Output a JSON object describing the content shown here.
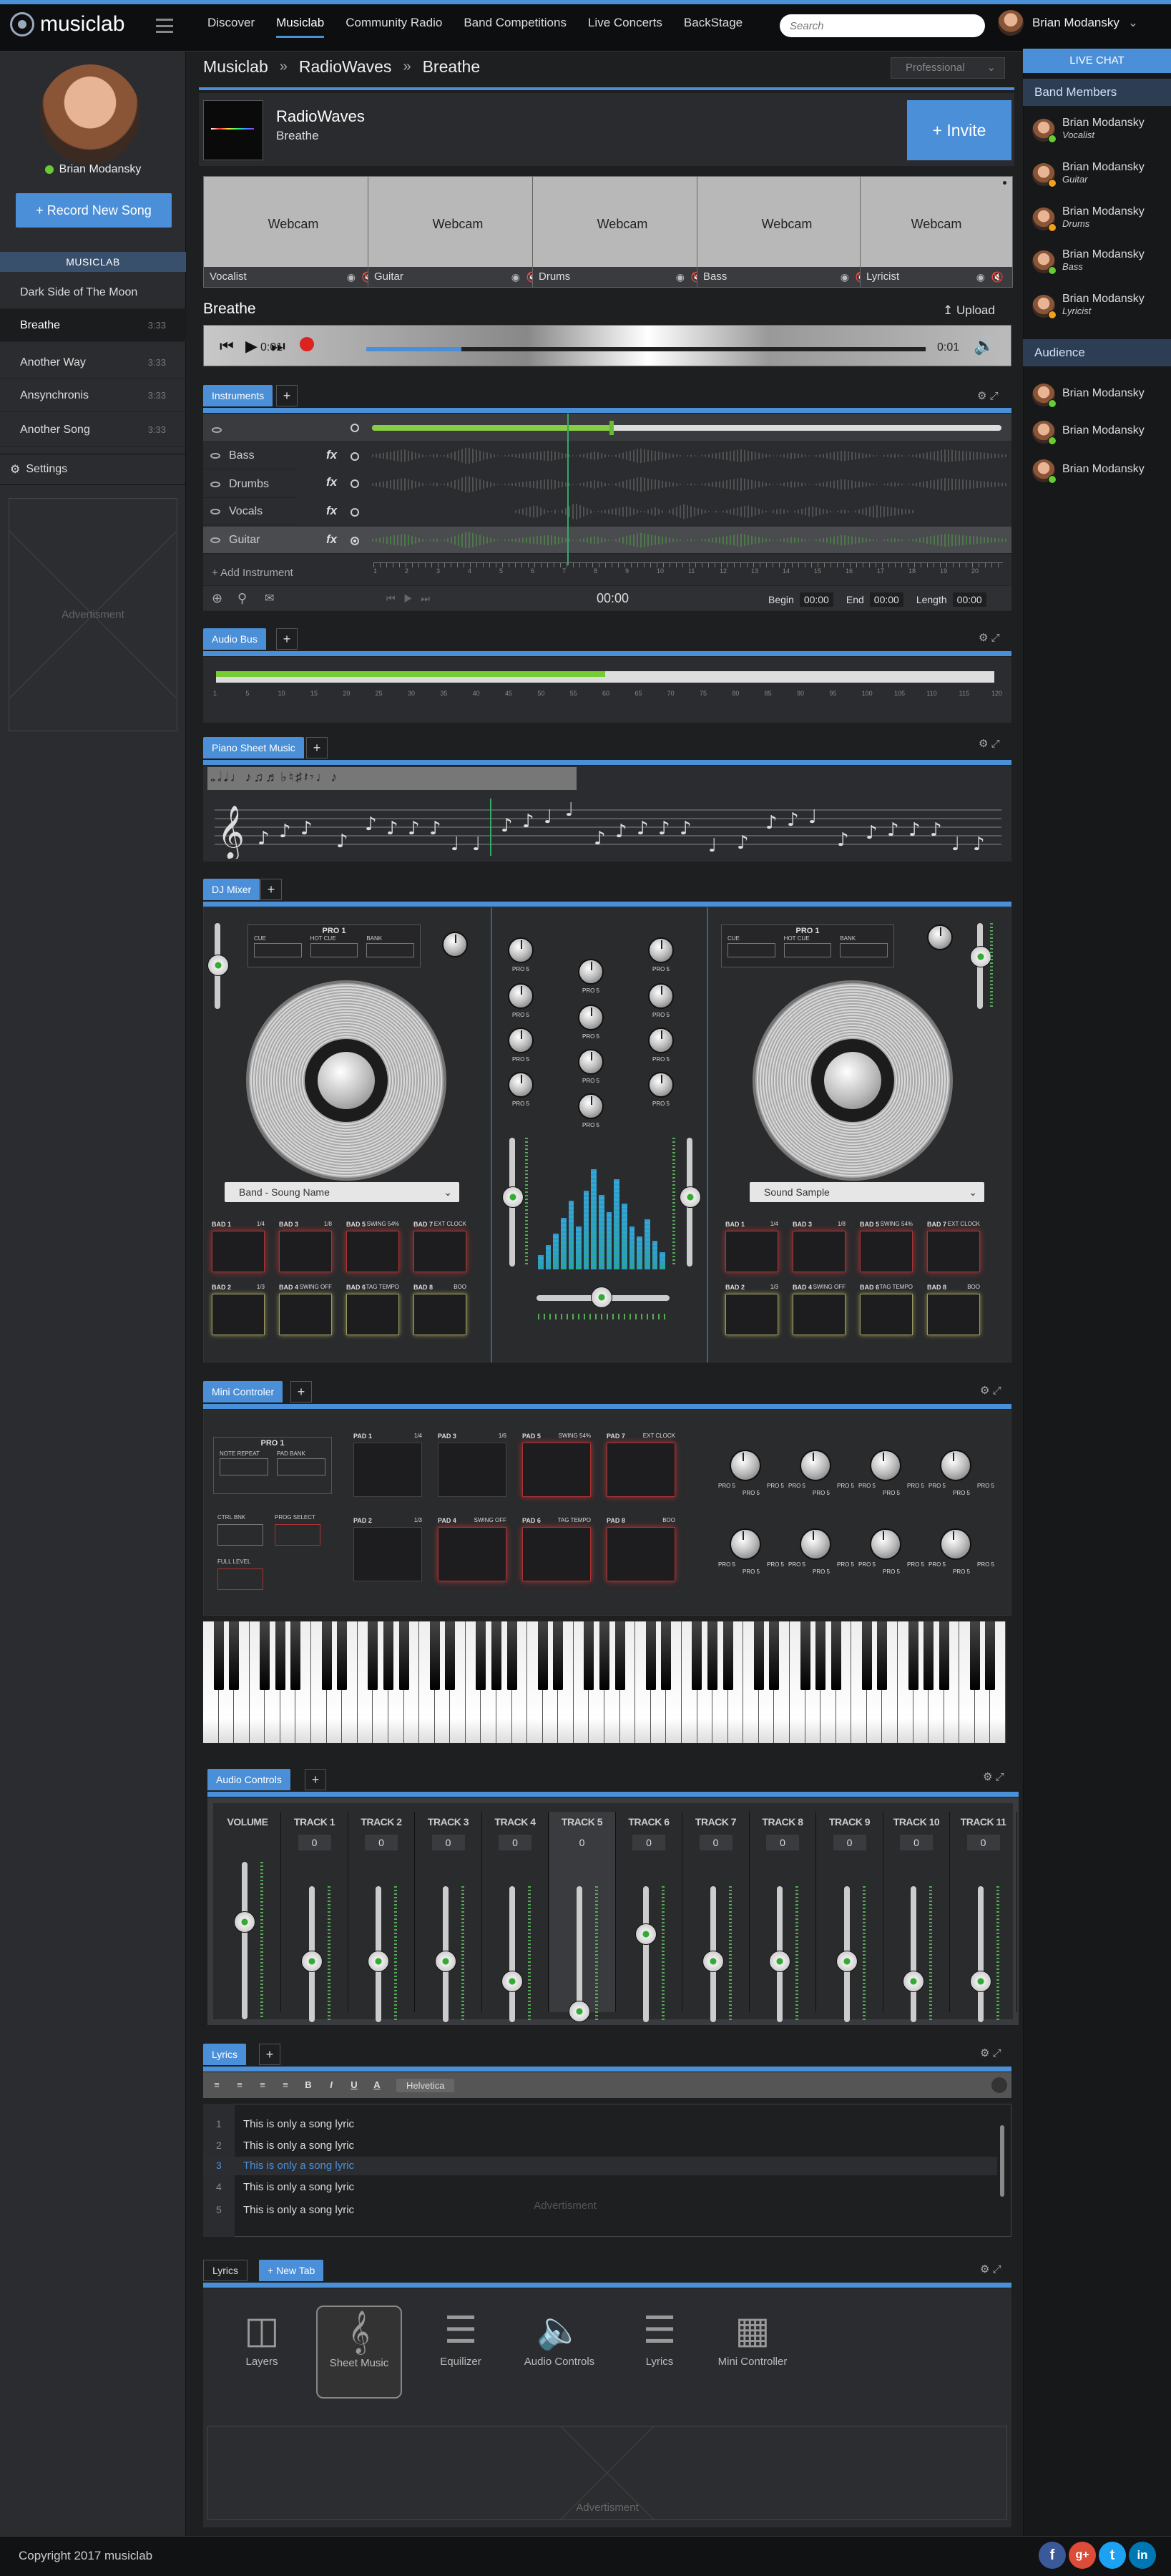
{
  "app": {
    "name": "musiclab"
  },
  "nav": {
    "items": [
      "Discover",
      "Musiclab",
      "Community Radio",
      "Band Competitions",
      "Live Concerts",
      "BackStage"
    ],
    "active": "Musiclab"
  },
  "search": {
    "placeholder": "Search"
  },
  "user": {
    "name": "Brian Modansky"
  },
  "sidebar": {
    "record_label": "Record New Song",
    "section_title": "MUSICLAB",
    "songs": [
      {
        "title": "Dark Side of The Moon",
        "duration": ""
      },
      {
        "title": "Breathe",
        "duration": "3:33"
      },
      {
        "title": "Another Way",
        "duration": "3:33"
      },
      {
        "title": "Ansynchronis",
        "duration": "3:33"
      },
      {
        "title": "Another Song",
        "duration": "3:33"
      }
    ],
    "settings_label": "Settings",
    "ad_label": "Advertisment"
  },
  "breadcrumb": {
    "items": [
      "Musiclab",
      "RadioWaves",
      "Breathe"
    ],
    "separator": "»"
  },
  "tier_select": {
    "value": "Professional"
  },
  "project": {
    "band": "RadioWaves",
    "song": "Breathe",
    "invite_label": "Invite"
  },
  "webcams": [
    {
      "label": "Webcam",
      "role": "Vocalist"
    },
    {
      "label": "Webcam",
      "role": "Guitar"
    },
    {
      "label": "Webcam",
      "role": "Drums"
    },
    {
      "label": "Webcam",
      "role": "Bass"
    },
    {
      "label": "Webcam",
      "role": "Lyricist"
    }
  ],
  "player": {
    "title": "Breathe",
    "upload_label": "Upload",
    "time_current": "0:01",
    "time_end": "0:01",
    "progress": 0.17
  },
  "instruments": {
    "tab": "Instruments",
    "tracks": [
      {
        "name": "Bass"
      },
      {
        "name": "Drumbs"
      },
      {
        "name": "Vocals"
      },
      {
        "name": "Guitar"
      }
    ],
    "fx_label": "fx",
    "add_label": "Add Instrument",
    "timecode": "00:00",
    "begin_label": "Begin",
    "begin_value": "00:00",
    "end_label": "End",
    "end_value": "00:00",
    "length_label": "Length",
    "length_value": "00:00",
    "ruler_ticks": [
      "1",
      "2",
      "3",
      "4",
      "5",
      "6",
      "7",
      "8",
      "9",
      "10",
      "11",
      "12",
      "13",
      "14",
      "15",
      "16",
      "17",
      "18",
      "19",
      "20"
    ],
    "playhead_fraction": 0.31
  },
  "audio_bus": {
    "tab": "Audio Bus",
    "level": 0.5,
    "ticks": [
      "1",
      "5",
      "10",
      "15",
      "20",
      "25",
      "30",
      "35",
      "40",
      "45",
      "50",
      "55",
      "60",
      "65",
      "70",
      "75",
      "80",
      "85",
      "90",
      "95",
      "100",
      "105",
      "110",
      "115",
      "120"
    ]
  },
  "sheet_music": {
    "tab": "Piano Sheet Music"
  },
  "dj_mixer": {
    "tab": "DJ Mixer",
    "deck_left": {
      "title": "PRO 1",
      "buttons": [
        "CUE",
        "HOT CUE",
        "BANK"
      ],
      "select": "Band - Soung Name"
    },
    "deck_right": {
      "title": "PRO 1",
      "buttons": [
        "CUE",
        "HOT CUE",
        "BANK"
      ],
      "select": "Sound Sample"
    },
    "knob_label": "PRO 5",
    "pads": [
      {
        "name": "BAD 1",
        "info": "1/4"
      },
      {
        "name": "BAD 3",
        "info": "1/8"
      },
      {
        "name": "BAD 5",
        "info": "SWING 54%"
      },
      {
        "name": "BAD 7",
        "info": "EXT CLOCK"
      },
      {
        "name": "BAD 2",
        "info": "1/3"
      },
      {
        "name": "BAD 4",
        "info": "SWING OFF"
      },
      {
        "name": "BAD 6",
        "info": "TAG TEMPO"
      },
      {
        "name": "BAD 8",
        "info": "BOO"
      }
    ]
  },
  "mini_controller": {
    "tab": "Mini Controler",
    "title": "PRO 1",
    "buttons": [
      "NOTE REPEAT",
      "PAD BANK",
      "CTRL BNK",
      "PROG SELECT",
      "FULL LEVEL"
    ],
    "pads": [
      {
        "name": "PAD 1",
        "info": "1/4"
      },
      {
        "name": "PAD 3",
        "info": "1/6"
      },
      {
        "name": "PAD 5",
        "info": "SWING 54%"
      },
      {
        "name": "PAD 7",
        "info": "EXT CLOCK"
      },
      {
        "name": "PAD 2",
        "info": "1/3"
      },
      {
        "name": "PAD 4",
        "info": "SWING OFF"
      },
      {
        "name": "PAD 6",
        "info": "TAG TEMPO"
      },
      {
        "name": "PAD 8",
        "info": "BOO"
      }
    ],
    "knob_label": "PRO 5"
  },
  "audio_controls": {
    "tab": "Audio Controls",
    "tracks": [
      {
        "name": "VOLUME",
        "value": "",
        "level": 0.62
      },
      {
        "name": "TRACK 1",
        "value": "0",
        "level": 0.45
      },
      {
        "name": "TRACK 2",
        "value": "0",
        "level": 0.45
      },
      {
        "name": "TRACK 3",
        "value": "0",
        "level": 0.45
      },
      {
        "name": "TRACK 4",
        "value": "0",
        "level": 0.3
      },
      {
        "name": "TRACK 5",
        "value": "0",
        "level": 0.08
      },
      {
        "name": "TRACK 6",
        "value": "0",
        "level": 0.65
      },
      {
        "name": "TRACK 7",
        "value": "0",
        "level": 0.45
      },
      {
        "name": "TRACK 8",
        "value": "0",
        "level": 0.45
      },
      {
        "name": "TRACK 9",
        "value": "0",
        "level": 0.45
      },
      {
        "name": "TRACK 10",
        "value": "0",
        "level": 0.3
      },
      {
        "name": "TRACK 11",
        "value": "0",
        "level": 0.3
      }
    ]
  },
  "lyrics": {
    "tab": "Lyrics",
    "font": "Helvetica",
    "lines": [
      "This is only a song lyric",
      "This is only a song lyric",
      "This is only a song lyric",
      "This is only a song lyric",
      "This is only a song lyric"
    ],
    "highlighted_line": 3,
    "ad_label": "Advertisment"
  },
  "new_tab": {
    "tabs": [
      "Lyrics",
      "New Tab"
    ],
    "items": [
      {
        "label": "Layers",
        "icon": "layers-icon"
      },
      {
        "label": "Sheet Music",
        "icon": "sheet-music-icon"
      },
      {
        "label": "Equilizer",
        "icon": "equalizer-icon"
      },
      {
        "label": "Audio Controls",
        "icon": "speaker-icon"
      },
      {
        "label": "Lyrics",
        "icon": "lyrics-icon"
      },
      {
        "label": "Mini Controller",
        "icon": "grid-icon"
      }
    ],
    "ad_label": "Advertisment"
  },
  "chat": {
    "title": "LIVE CHAT",
    "band_title": "Band Members",
    "band": [
      {
        "name": "Brian Modansky",
        "role": "Vocalist"
      },
      {
        "name": "Brian Modansky",
        "role": "Guitar"
      },
      {
        "name": "Brian Modansky",
        "role": "Drums"
      },
      {
        "name": "Brian Modansky",
        "role": "Bass"
      },
      {
        "name": "Brian Modansky",
        "role": "Lyricist"
      }
    ],
    "audience_title": "Audience",
    "audience": [
      {
        "name": "Brian Modansky"
      },
      {
        "name": "Brian Modansky"
      },
      {
        "name": "Brian Modansky"
      }
    ]
  },
  "footer": {
    "copyright": "Copyright 2017 musiclab",
    "social": [
      "f",
      "g+",
      "t",
      "in"
    ]
  },
  "colors": {
    "accent": "#4a8fd8",
    "background": "#1e1f21",
    "panel": "#2b2c2f",
    "online": "#66cc33",
    "away": "#f0a020"
  }
}
